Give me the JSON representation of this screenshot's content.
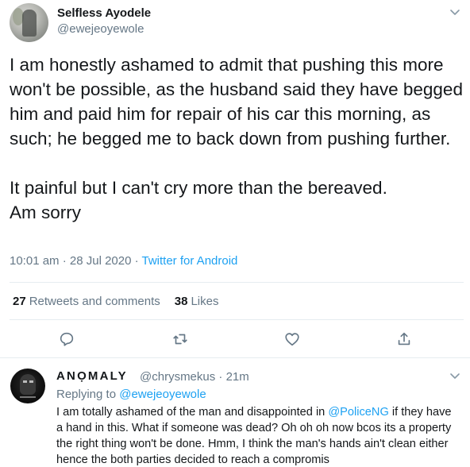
{
  "tweet": {
    "author_name": "Selfless Ayodele",
    "author_handle": "@ewejeoyewole",
    "text": "I am honestly ashamed to admit that pushing this more won't be possible, as the husband said they have begged him and paid him for repair of his car this morning, as such; he begged me to back down from pushing further.\n\nIt painful but I can't cry more than the bereaved.\nAm sorry",
    "timestamp": "10:01 am · 28 Jul 2020 · ",
    "source": "Twitter for Android",
    "retweets_count": "27",
    "retweets_label": "Retweets and comments",
    "likes_count": "38",
    "likes_label": "Likes",
    "menu_icon": "chevron-down-icon"
  },
  "actions": [
    {
      "name": "reply",
      "icon": "comment-icon"
    },
    {
      "name": "retweet",
      "icon": "retweet-icon"
    },
    {
      "name": "like",
      "icon": "heart-icon"
    },
    {
      "name": "share",
      "icon": "share-icon"
    }
  ],
  "reply": {
    "author_name": "ANỌMALY",
    "author_handle": "@chrysmekus · 21m",
    "replying_prefix": "Replying to ",
    "replying_to": "@ewejeoyewole",
    "text_part1": "I am totally ashamed of the man and disappointed in ",
    "mention": "@PoliceNG",
    "text_part2": " if they have a hand in this. What if someone was dead? Oh oh oh now bcos its a property the right thing won't be done. Hmm, I think the man's hands ain't clean either hence the both parties decided to reach a compromis"
  },
  "colors": {
    "text_primary": "#14171a",
    "text_secondary": "#657786",
    "link": "#1da1f2",
    "divider": "#e6ecf0"
  }
}
